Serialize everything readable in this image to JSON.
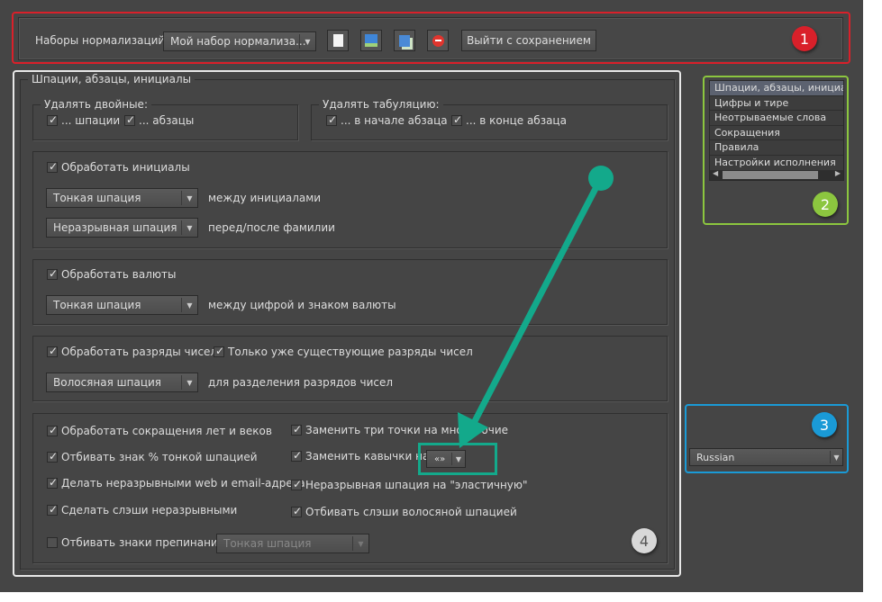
{
  "colors": {
    "annotation1": "#d9202a",
    "annotation2": "#8cc63f",
    "annotation3": "#1a9ad6",
    "annotation4": "#d8d8d8",
    "arrow": "#13a98b"
  },
  "toolbar": {
    "label": "Наборы нормализаций",
    "preset": "Мой набор нормализа...",
    "icons": [
      "new-document-icon",
      "save-icon",
      "copy-icon",
      "delete-icon"
    ],
    "save_exit": "Выйти с сохранением"
  },
  "badges": {
    "b1": "1",
    "b2": "2",
    "b3": "3",
    "b4": "4"
  },
  "main": {
    "title": "Шпации, абзацы, инициалы",
    "dbl": {
      "title": "Удалять двойные:",
      "spaces": "... шпации",
      "paras": "... абзацы"
    },
    "tabs": {
      "title": "Удалять табуляцию:",
      "start": "... в начале абзаца",
      "end": "... в конце абзаца"
    },
    "initials": {
      "check": "Обработать инициалы",
      "sel1": "Тонкая шпация",
      "lbl1": "между инициалами",
      "sel2": "Неразрывная шпация",
      "lbl2": "перед/после фамилии"
    },
    "currency": {
      "check": "Обработать валюты",
      "sel": "Тонкая шпация",
      "lbl": "между цифрой и знаком валюты"
    },
    "digits": {
      "check": "Обработать разряды чисел",
      "check2": "Только уже существующие разряды чисел",
      "sel": "Волосяная шпация",
      "lbl": "для разделения разрядов чисел"
    },
    "misc": {
      "c1": "Обработать сокращения лет и веков",
      "c2": "Отбивать знак % тонкой шпацией",
      "c3": "Делать неразрывными web и email-адреса",
      "c4": "Сделать слэши неразрывными",
      "c5": "Отбивать знаки препинания",
      "c5sel": "Тонкая шпация",
      "r1": "Заменить три точки на многоточие",
      "r2": "Заменить кавычки на",
      "r2sel": "«»",
      "r3": "Неразрывная шпация на \"эластичную\"",
      "r4": "Отбивать слэши волосяной шпацией"
    }
  },
  "sections": [
    "Шпации, абзацы, инициалы",
    "Цифры и тире",
    "Неотрываемые слова",
    "Сокращения",
    "Правила",
    "Настройки исполнения"
  ],
  "language": "Russian"
}
